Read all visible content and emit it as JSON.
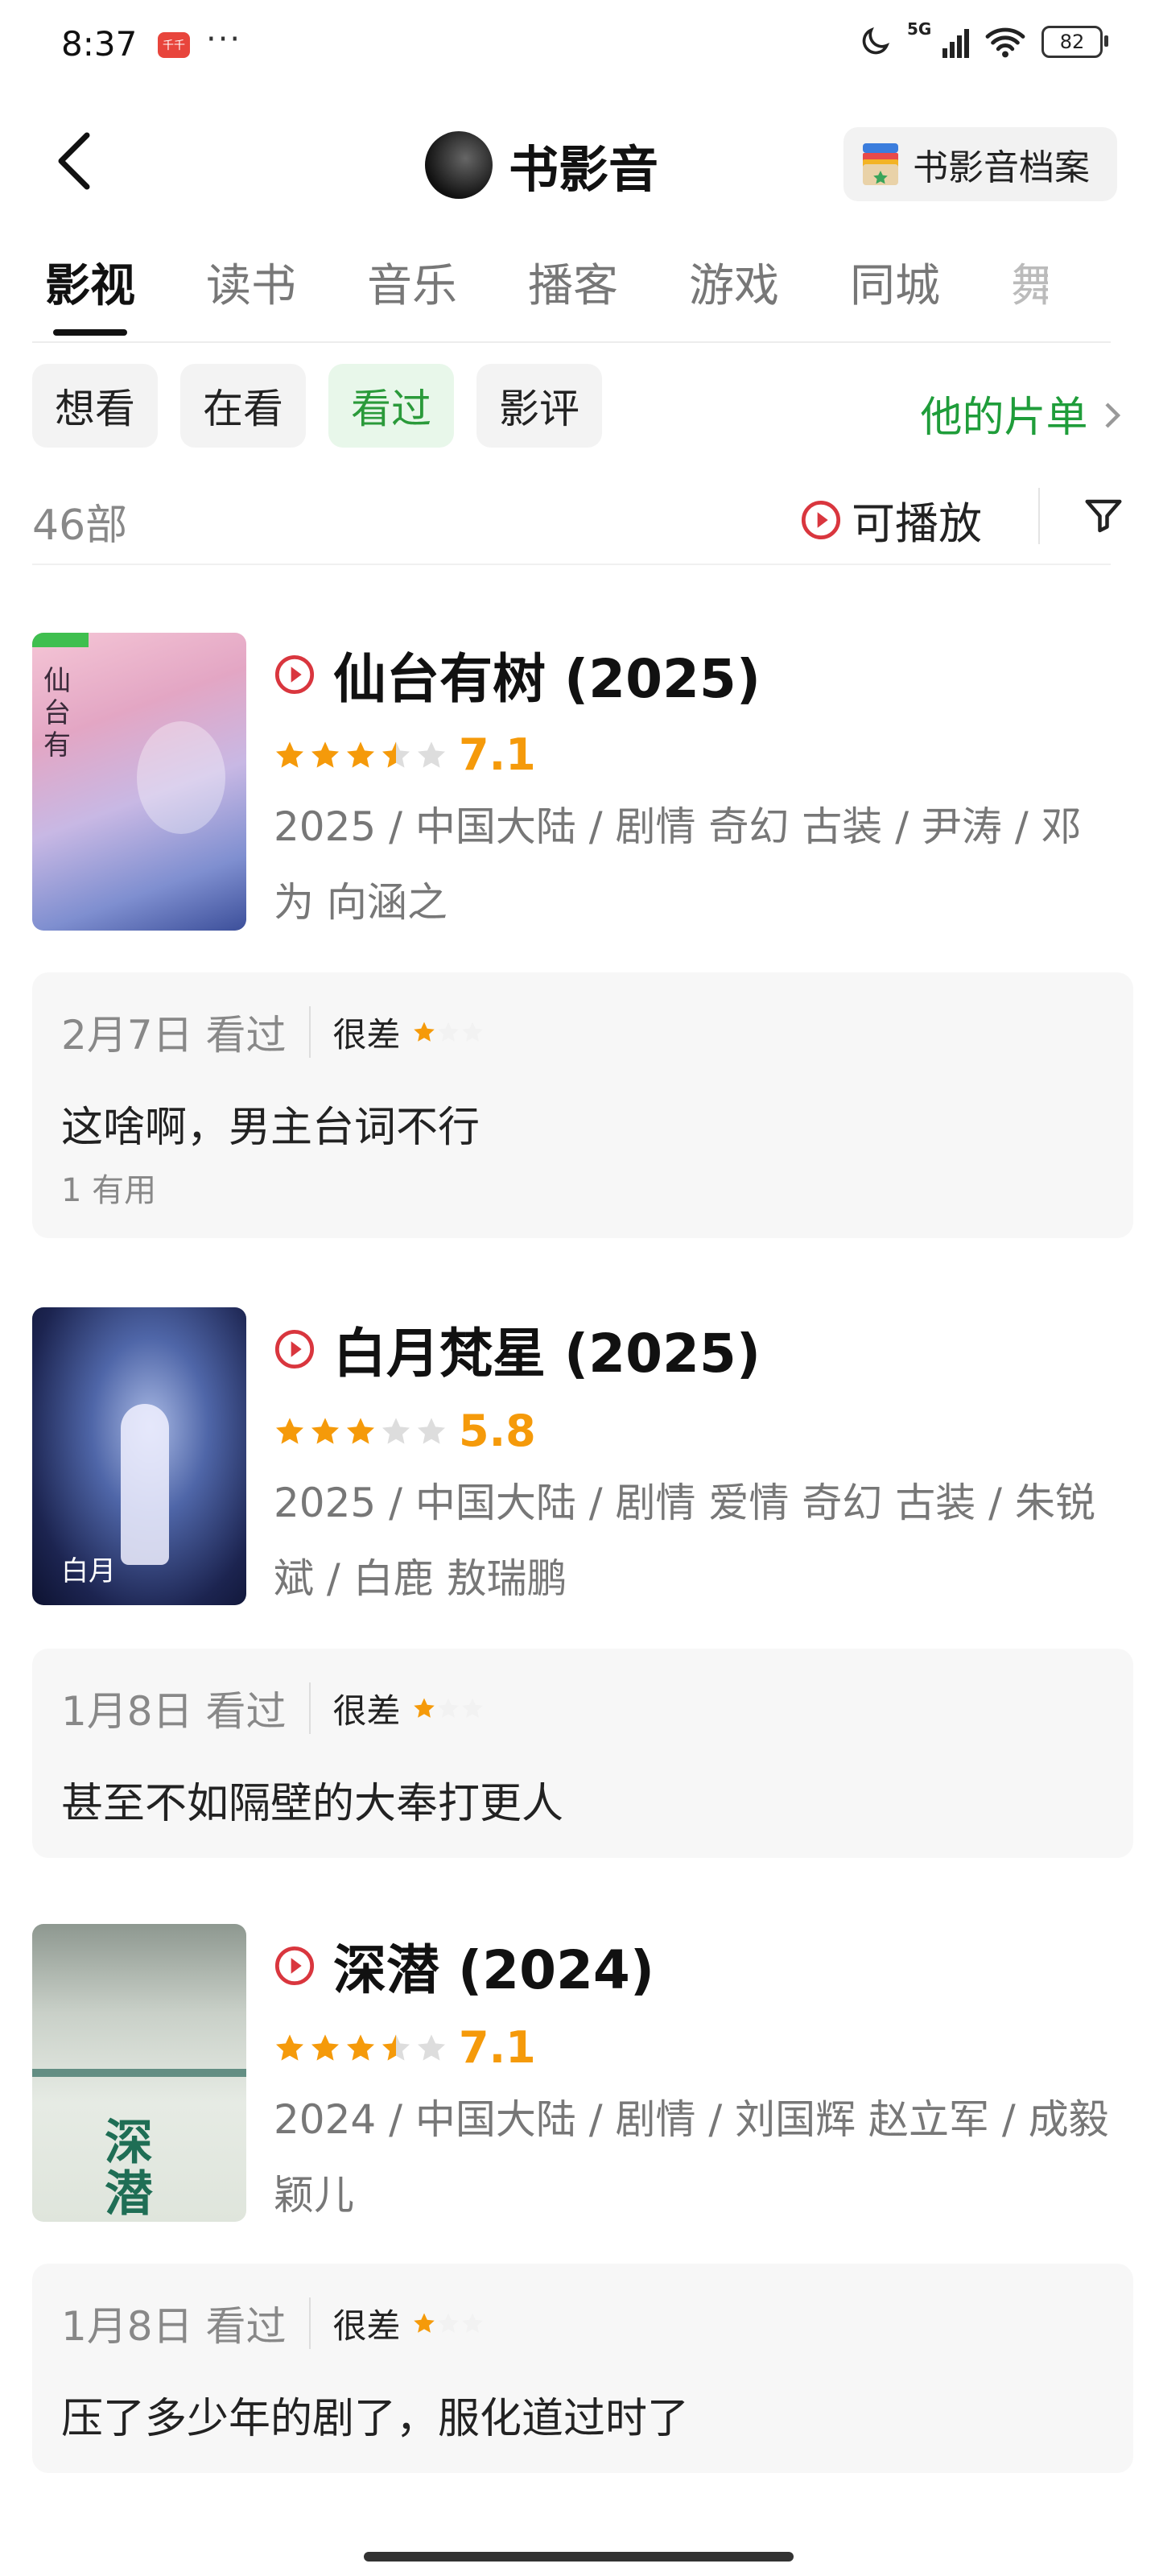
{
  "status_bar": {
    "time": "8:37",
    "app_icon_text": "千千",
    "dots": "···",
    "signal_label": "5G",
    "battery": "82"
  },
  "header": {
    "title": "书影音",
    "archive_label": "书影音档案"
  },
  "tabs": [
    {
      "label": "影视",
      "active": true
    },
    {
      "label": "读书"
    },
    {
      "label": "音乐"
    },
    {
      "label": "播客"
    },
    {
      "label": "游戏"
    },
    {
      "label": "同城"
    },
    {
      "label": "舞"
    }
  ],
  "filters": [
    {
      "label": "想看"
    },
    {
      "label": "在看"
    },
    {
      "label": "看过",
      "active": true
    },
    {
      "label": "影评"
    }
  ],
  "list_link": "他的片单",
  "count": "46部",
  "playable_label": "可播放",
  "colors": {
    "accent_green": "#1f9d3a",
    "star": "#f59a0a",
    "play_red": "#d9363e"
  },
  "movies": [
    {
      "title": "仙台有树 (2025)",
      "rating_stars": 3.5,
      "score": "7.1",
      "meta": "2025 / 中国大陆 / 剧情 奇幻 古装 / 尹涛 / 邓为 向涵之",
      "comment": {
        "date": "2月7日 看过",
        "rating_label": "很差",
        "user_stars": 1,
        "text": "这啥啊，男主台词不行",
        "useful": "1 有用"
      }
    },
    {
      "title": "白月梵星 (2025)",
      "rating_stars": 3,
      "score": "5.8",
      "meta": "2025 / 中国大陆 / 剧情 爱情 奇幻 古装 / 朱锐斌 / 白鹿 敖瑞鹏",
      "comment": {
        "date": "1月8日 看过",
        "rating_label": "很差",
        "user_stars": 1,
        "text": "甚至不如隔壁的大奉打更人"
      }
    },
    {
      "title": "深潜 (2024)",
      "rating_stars": 3.5,
      "score": "7.1",
      "meta": "2024 / 中国大陆 / 剧情 / 刘国辉 赵立军 / 成毅 颖儿",
      "comment": {
        "date": "1月8日 看过",
        "rating_label": "很差",
        "user_stars": 1,
        "text": "压了多少年的剧了，服化道过时了"
      }
    }
  ]
}
